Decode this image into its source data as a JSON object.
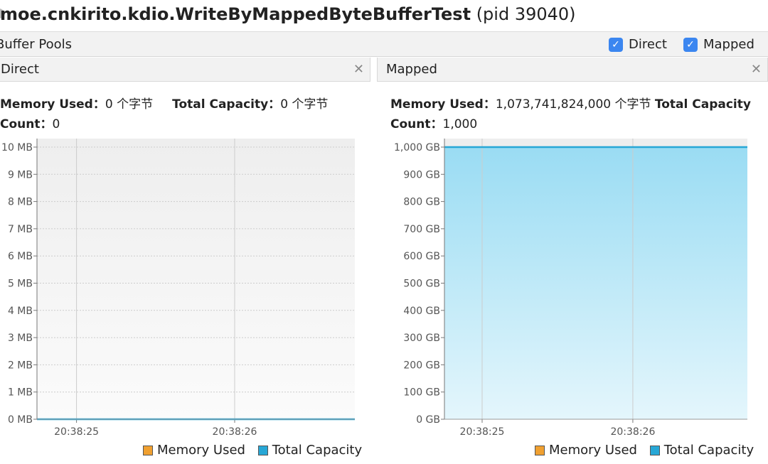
{
  "window": {
    "title_app": "moe.cnkirito.kdio.WriteByMappedByteBufferTest",
    "title_pid": "(pid 39040)"
  },
  "pools": {
    "label": "Buffer Pools",
    "checkboxes": [
      {
        "label": "Direct",
        "checked": true
      },
      {
        "label": "Mapped",
        "checked": true
      }
    ]
  },
  "colors": {
    "memory_used": "#f0a030",
    "total_capacity": "#27a7d6",
    "checkbox": "#3b86f0"
  },
  "panels": [
    {
      "tab": "Direct",
      "close_icon": "close-icon",
      "mem_label": "Memory Used：",
      "mem_value": "0 个字节",
      "cap_label": "Total Capacity：",
      "cap_value": "0 个字节",
      "count_label": "Count：",
      "count_value": "0"
    },
    {
      "tab": "Mapped",
      "close_icon": "close-icon",
      "mem_label": "Memory Used：",
      "mem_value": "1,073,741,824,000 个字节",
      "cap_label": "Total Capacity",
      "count_label": "Count：",
      "count_value": "1,000"
    }
  ],
  "chart_data": [
    {
      "type": "area",
      "unit": "MB",
      "ylim": [
        0,
        10
      ],
      "y_ticks": [
        "0 MB",
        "1 MB",
        "2 MB",
        "3 MB",
        "4 MB",
        "5 MB",
        "6 MB",
        "7 MB",
        "8 MB",
        "9 MB",
        "10 MB"
      ],
      "x_ticks": [
        "20:38:25",
        "20:38:26"
      ],
      "x_range": [
        "20:38:24.75",
        "20:38:26.76"
      ],
      "grid": true,
      "legend": "bottom-right",
      "series": [
        {
          "name": "Memory Used",
          "x": [
            "20:38:24.75",
            "20:38:26.76"
          ],
          "values": [
            0,
            0
          ]
        },
        {
          "name": "Total Capacity",
          "x": [
            "20:38:24.75",
            "20:38:26.76"
          ],
          "values": [
            0,
            0
          ]
        }
      ]
    },
    {
      "type": "area",
      "unit": "GB",
      "ylim": [
        0,
        1000
      ],
      "y_ticks": [
        "0 GB",
        "100 GB",
        "200 GB",
        "300 GB",
        "400 GB",
        "500 GB",
        "600 GB",
        "700 GB",
        "800 GB",
        "900 GB",
        "1,000 GB"
      ],
      "x_ticks": [
        "20:38:25",
        "20:38:26"
      ],
      "x_range": [
        "20:38:24.75",
        "20:38:26.76"
      ],
      "grid": true,
      "legend": "bottom-right",
      "series": [
        {
          "name": "Memory Used",
          "x": [
            "20:38:24.75",
            "20:38:26.76"
          ],
          "values": [
            1000,
            1000
          ]
        },
        {
          "name": "Total Capacity",
          "x": [
            "20:38:24.75",
            "20:38:26.76"
          ],
          "values": [
            1000,
            1000
          ]
        }
      ]
    }
  ]
}
